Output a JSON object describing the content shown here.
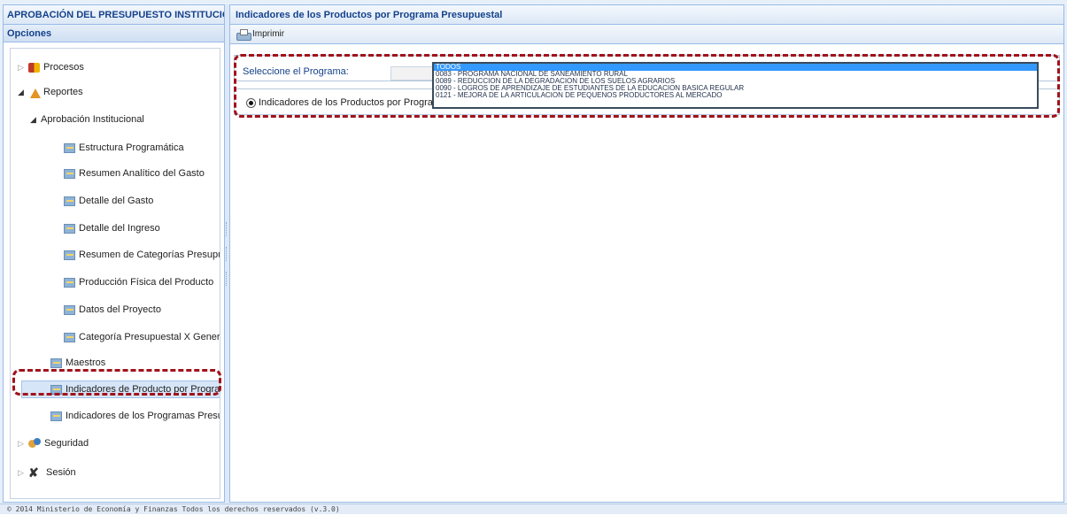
{
  "west": {
    "title": "APROBACIÓN DEL PRESUPUESTO INSTITUCIONAL",
    "subtitle": "Opciones"
  },
  "tree": {
    "procesos": "Procesos",
    "reportes": "Reportes",
    "aprobacion": "Aprobación Institucional",
    "items": [
      "Estructura Programática",
      "Resumen Analítico del Gasto",
      "Detalle del Gasto",
      "Detalle del Ingreso",
      "Resumen de Categorías Presupuestales",
      "Producción Física del Producto",
      "Datos del Proyecto",
      "Categoría Presupuestal X Generica"
    ],
    "maestros": "Maestros",
    "indicadores_producto": "Indicadores de Producto por Programa",
    "indicadores_programas": "Indicadores de los Programas Presupuestales",
    "seguridad": "Seguridad",
    "sesion": "Sesión"
  },
  "center": {
    "title": "Indicadores de los Productos por Programa Presupuestal",
    "print_label": "Imprimir",
    "select_label": "Seleccione el Programa:",
    "radio_label": "Indicadores de los Productos por Programa Presupuestal"
  },
  "dropdown": {
    "options": [
      "TODOS",
      "0083 - PROGRAMA NACIONAL DE SANEAMIENTO RURAL",
      "0089 - REDUCCION DE LA DEGRADACION DE LOS SUELOS AGRARIOS",
      "0090 - LOGROS DE APRENDIZAJE DE ESTUDIANTES DE LA EDUCACION BASICA REGULAR",
      "0121 - MEJORA DE LA ARTICULACION DE PEQUEÑOS PRODUCTORES AL MERCADO"
    ],
    "selected": "TODOS"
  },
  "footer": "© 2014 Ministerio de Economía y Finanzas Todos los derechos reservados (v.3.0)",
  "colors": {
    "header_text": "#15428b",
    "highlight": "#a1121b",
    "selected_option": "#3399ff"
  }
}
